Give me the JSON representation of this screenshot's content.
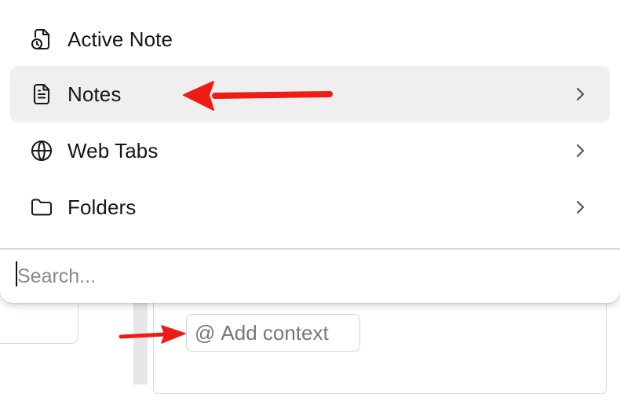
{
  "menu": {
    "items": [
      {
        "label": "Active Note",
        "icon": "note-clock-icon",
        "has_submenu": false,
        "highlighted": false
      },
      {
        "label": "Notes",
        "icon": "document-icon",
        "has_submenu": true,
        "highlighted": true
      },
      {
        "label": "Web Tabs",
        "icon": "globe-icon",
        "has_submenu": true,
        "highlighted": false
      },
      {
        "label": "Folders",
        "icon": "folder-icon",
        "has_submenu": true,
        "highlighted": false
      }
    ]
  },
  "search": {
    "placeholder": "Search...",
    "value": ""
  },
  "background": {
    "add_context_symbol": "@",
    "add_context_label": "Add context"
  },
  "annotations": {
    "arrow_color": "#ee1c14"
  },
  "colors": {
    "highlight": "#efefef",
    "text": "#161616",
    "placeholder": "#8a8a8a"
  }
}
